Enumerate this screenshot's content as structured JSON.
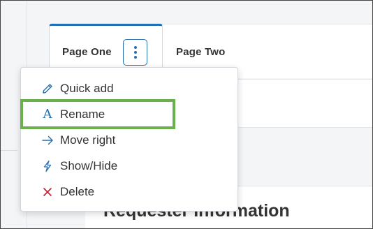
{
  "tabs": [
    {
      "label": "Page One",
      "active": true
    },
    {
      "label": "Page Two",
      "active": false
    }
  ],
  "tab_menu": {
    "items": [
      {
        "label": "Quick add",
        "icon": "pencil-icon"
      },
      {
        "label": "Rename",
        "icon": "rename-icon"
      },
      {
        "label": "Move right",
        "icon": "arrow-right-icon"
      },
      {
        "label": "Show/Hide",
        "icon": "lightning-icon"
      },
      {
        "label": "Delete",
        "icon": "close-icon"
      }
    ],
    "highlighted_item": "Rename"
  },
  "section": {
    "title": "Requester Information"
  },
  "colors": {
    "accent": "#2a6fb0",
    "highlight": "#6ab04c",
    "delete": "#c41d2f",
    "text": "#333333"
  }
}
